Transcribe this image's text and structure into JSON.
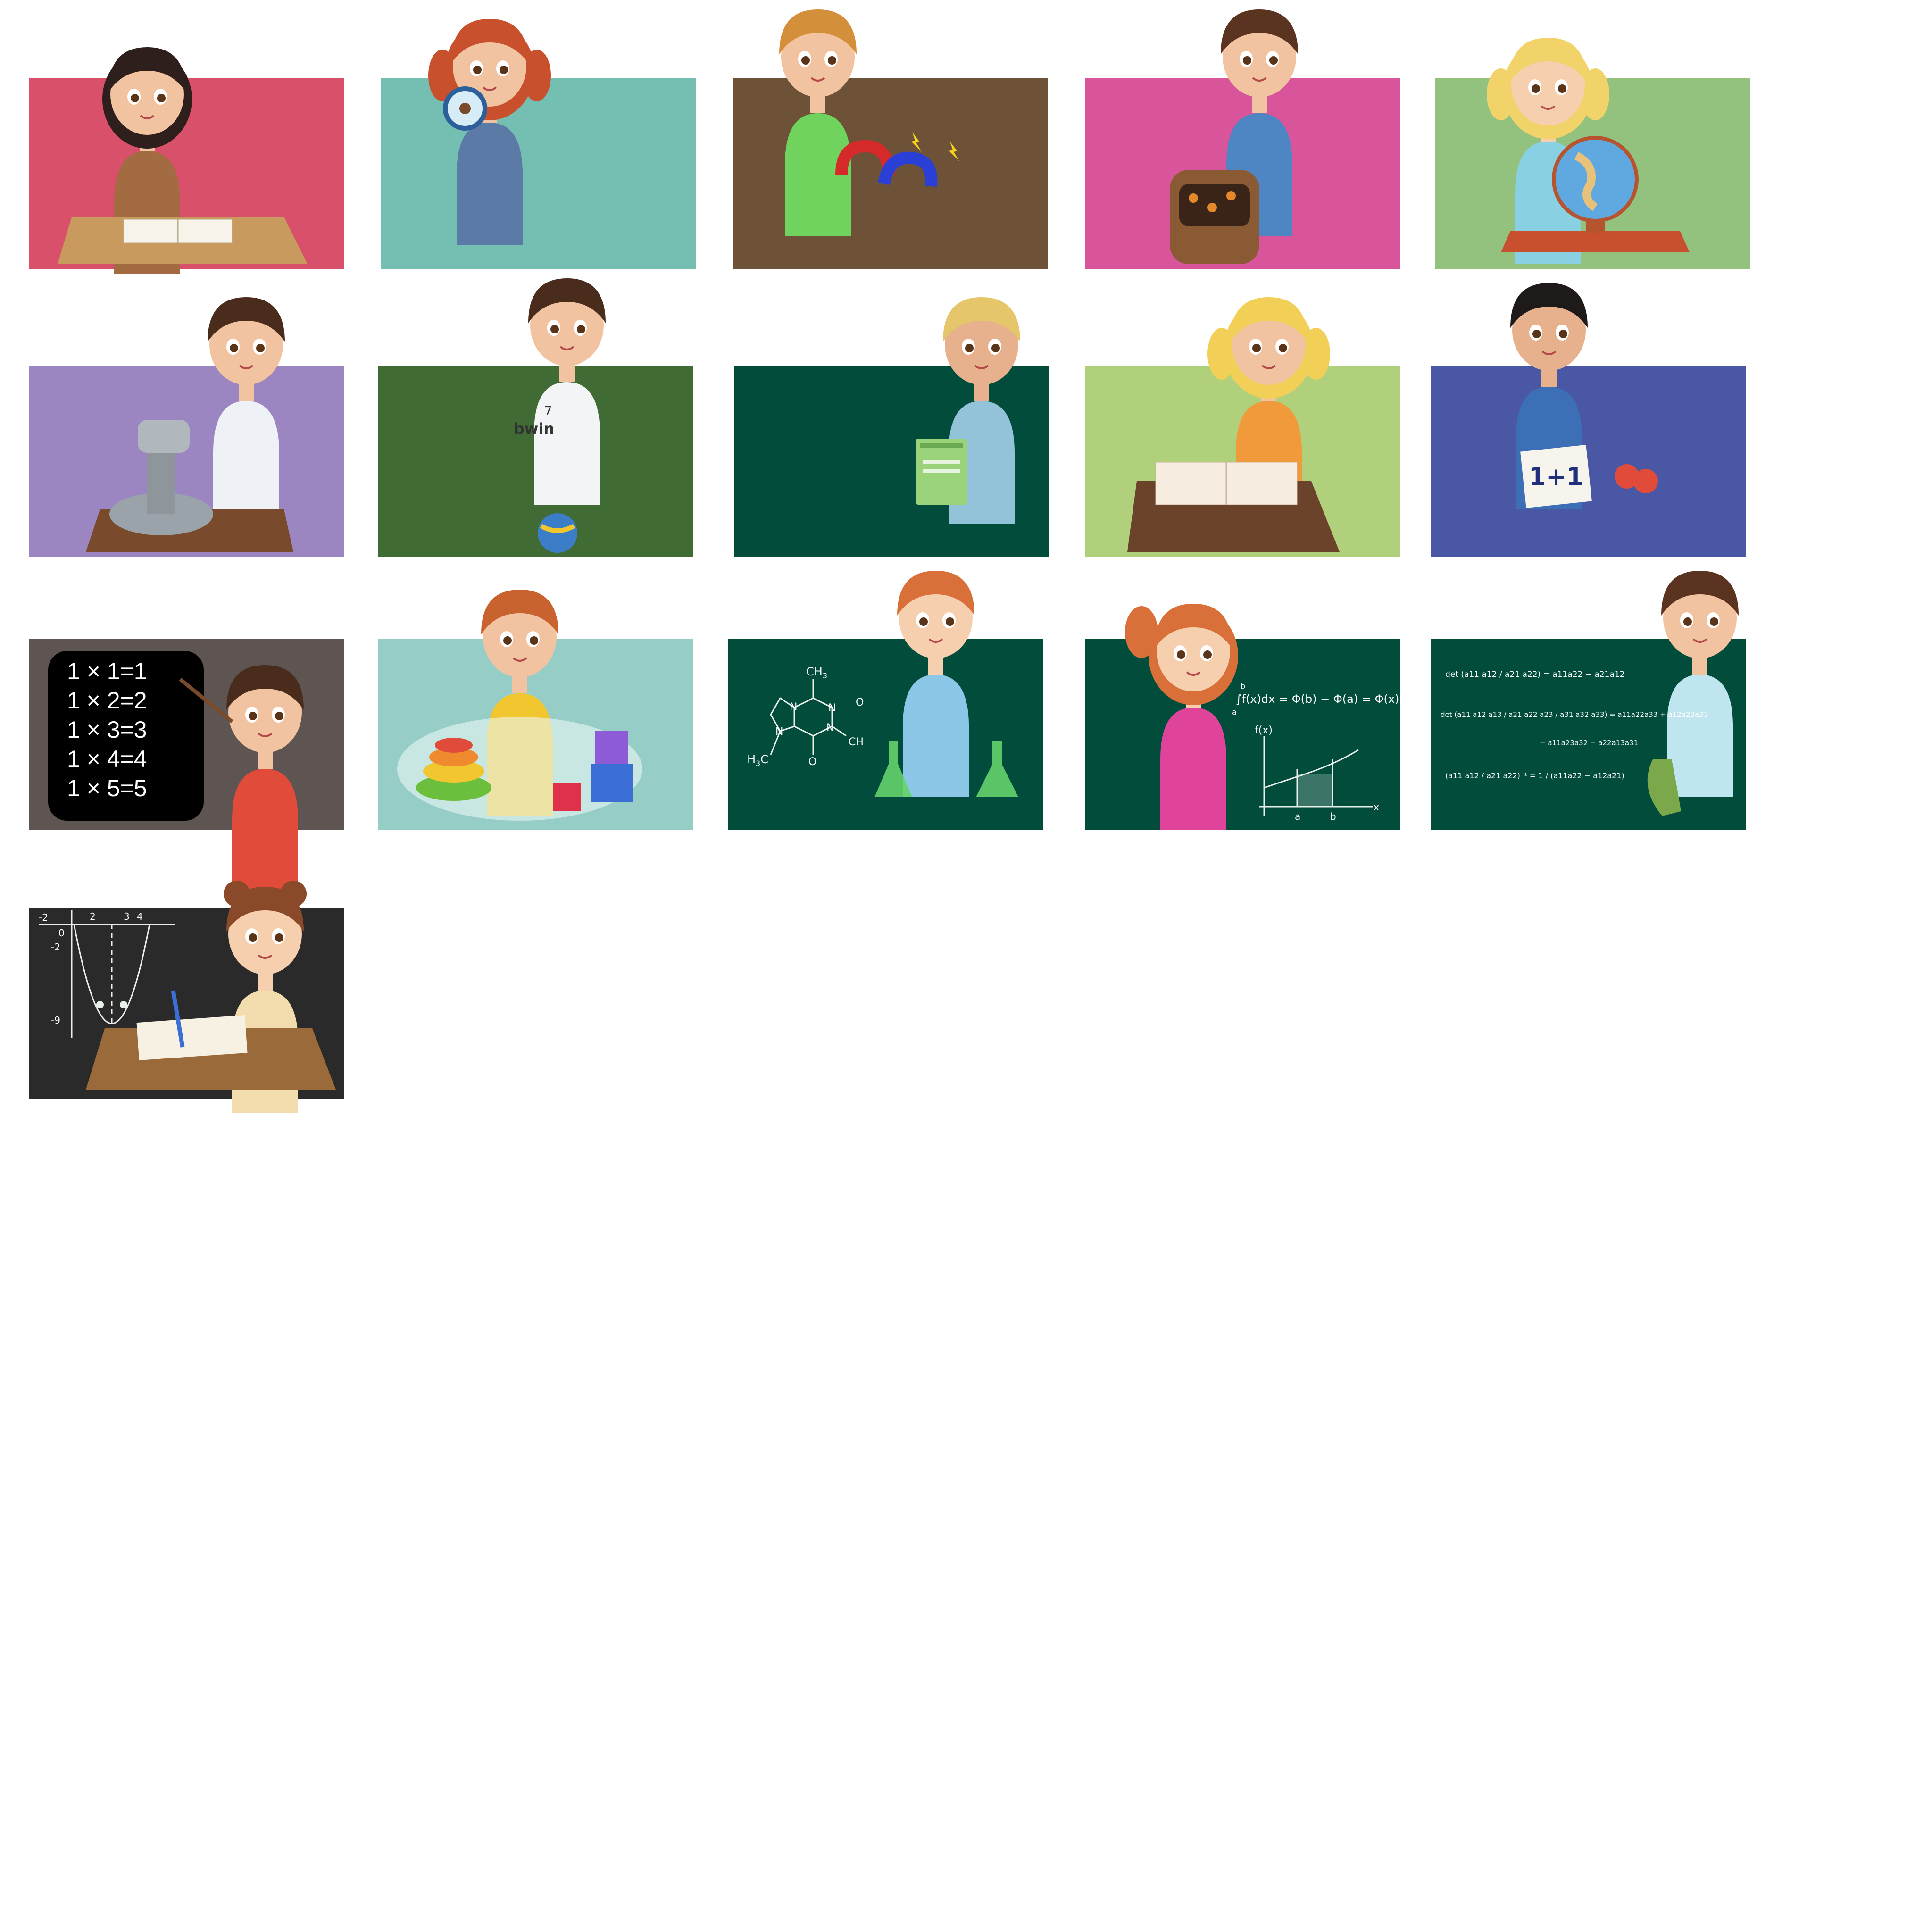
{
  "palette": {
    "page_bg": "#ffffff",
    "skin": "#f2c3a0",
    "skin_shade": "#e0a27e",
    "eye": "#5a3418",
    "mouth": "#b5484a",
    "table": "#c89a5e",
    "chalk": "#e9efe9"
  },
  "cards": [
    {
      "id": "girl-raising-hand",
      "bg": "#d9506a",
      "hair": "#2e1e1c",
      "shirt": "#a36b42",
      "hair_style": "bob",
      "skin": "#f2c3a0",
      "prop": "book"
    },
    {
      "id": "girl-magnifier",
      "bg": "#74bfb2",
      "hair": "#c8502d",
      "shirt": "#5b7aa6",
      "hair_style": "pigtails",
      "skin": "#f2c3a0",
      "prop": "magnifier"
    },
    {
      "id": "boy-magnets",
      "bg": "#6e5238",
      "hair": "#d48f3b",
      "shirt": "#6fd35d",
      "hair_style": "short",
      "skin": "#f2c3a0",
      "prop": "magnet"
    },
    {
      "id": "boy-backpack",
      "bg": "#d9559b",
      "hair": "#5a3420",
      "shirt": "#4d86c2",
      "hair_style": "short",
      "skin": "#f2c3a0",
      "prop": "backpack"
    },
    {
      "id": "girl-globe",
      "bg": "#93c27f",
      "hair": "#f1d36a",
      "shirt": "#8ad0e3",
      "hair_style": "pigtails",
      "skin": "#f6cfae",
      "prop": "globe"
    },
    {
      "id": "boy-microscope",
      "bg": "#9b86c2",
      "hair": "#4a2c1c",
      "shirt": "#eef2f6",
      "hair_style": "curly",
      "skin": "#f2c3a0",
      "prop": "microscope"
    },
    {
      "id": "boy-football",
      "bg": "#416b34",
      "hair": "#4a2c1c",
      "shirt": "#f3f4f6",
      "hair_style": "short",
      "skin": "#f2c3a0",
      "prop": "ball"
    },
    {
      "id": "boy-books",
      "bg": "#024c3c",
      "hair": "#e6c66a",
      "shirt": "#93c3d9",
      "hair_style": "short",
      "skin": "#e7b18d",
      "prop": "books"
    },
    {
      "id": "girl-reading",
      "bg": "#b0d07b",
      "hair": "#f2cf57",
      "shirt": "#f09a3b",
      "hair_style": "pigtails",
      "skin": "#f2c3a0",
      "prop": "book"
    },
    {
      "id": "two-boys-sum",
      "bg": "#4a57a4",
      "hair": "#1f1a1a",
      "shirt": "#3d6fb6",
      "hair_style": "short",
      "skin": "#e7b18d",
      "prop": "sign"
    },
    {
      "id": "boy-multiplication",
      "bg": "#5e5552",
      "hair": "#4a2c1c",
      "shirt": "#e04b3a",
      "hair_style": "short",
      "skin": "#f2c3a0",
      "prop": "pointer"
    },
    {
      "id": "boy-toys",
      "bg": "#96cec7",
      "hair": "#c8632f",
      "shirt": "#f2c62e",
      "hair_style": "short",
      "skin": "#f2c3a0",
      "prop": "toys"
    },
    {
      "id": "boy-chemist",
      "bg": "#024c3c",
      "hair": "#d9703a",
      "shirt": "#8cc7e8",
      "hair_style": "short",
      "skin": "#f6cfae",
      "prop": "flasks"
    },
    {
      "id": "girl-integral",
      "bg": "#024c3c",
      "hair": "#d9703a",
      "shirt": "#e0449a",
      "hair_style": "ponytail",
      "skin": "#f6cfae",
      "prop": "none"
    },
    {
      "id": "boy-matrix",
      "bg": "#024c3c",
      "hair": "#5a3420",
      "shirt": "#bfe6ee",
      "hair_style": "short",
      "skin": "#f2c3a0",
      "prop": "bag"
    },
    {
      "id": "girl-parabola",
      "bg": "#2a2a2a",
      "hair": "#8a4a2a",
      "shirt": "#f3dcae",
      "hair_style": "buns",
      "skin": "#f6cfae",
      "prop": "notebook"
    }
  ],
  "boards": {
    "mult": [
      "1 × 1=1",
      "1 × 2=2",
      "1 × 3=3",
      "1 × 4=4",
      "1 × 5=5"
    ],
    "sum_sign": "1+1",
    "jersey_text": "bwin",
    "jersey_number": "7",
    "chem_ch3_top": "CH",
    "chem_ch3_top_sub": "3",
    "chem_h3c": "H",
    "chem_h3c_sub": "3",
    "chem_h3c_end": "C",
    "chem_n1": "N",
    "chem_n2": "N",
    "chem_n3": "N",
    "chem_n4": "N",
    "chem_o1": "O",
    "chem_o2": "O",
    "chem_ch_mid": "CH",
    "integral_formula": "∫f(x)dx = Φ(b) − Φ(a) = Φ(x)|",
    "integral_lower": "a",
    "integral_upper": "b",
    "graph_fx": "f(x)",
    "graph_a": "a",
    "graph_b": "b",
    "graph_x": "x",
    "det2": "det (a11 a12 / a21 a22) = a11a22 − a21a12",
    "det3_line1": "det (a11 a12 a13 / a21 a22 a23 / a31 a32 a33) = a11a22a33 + a12a23a31",
    "det3_line2": "− a11a23a32 − a22a13a31",
    "inverse": "(a11 a12 / a21 a22)⁻¹ = 1 / (a11a22 − a12a21)",
    "parabola_ticks_x": [
      "-2",
      "2",
      "3",
      "4"
    ],
    "parabola_ticks_y": [
      "0",
      "-2",
      "-9"
    ]
  }
}
